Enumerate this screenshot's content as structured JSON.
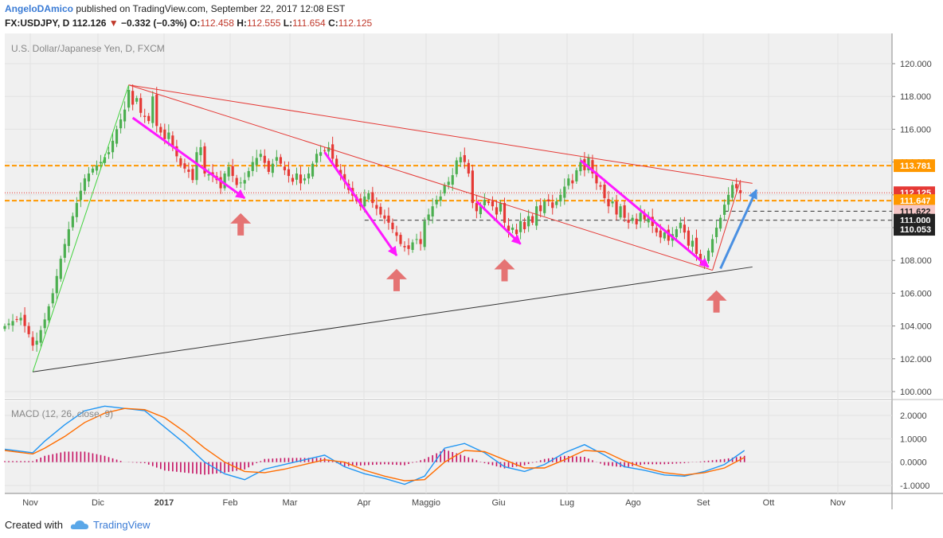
{
  "header": {
    "author": "AngeloDAmico",
    "published": "published on TradingView.com, September 22, 2017 12:08 EST",
    "symbol": "FX:USDJPY, D",
    "last": "112.126",
    "change": "−0.332 (−0.3%)",
    "o_label": "O:",
    "o_value": "112.458",
    "h_label": "H:",
    "h_value": "112.555",
    "l_label": "L:",
    "l_value": "111.654",
    "c_label": "C:",
    "c_value": "112.125"
  },
  "footer": {
    "created": "Created with",
    "brand": "TradingView"
  },
  "colors": {
    "up": "#4caf50",
    "down": "#e53935",
    "trend": "#e53935",
    "magenta": "#ff19ff",
    "orange": "#ff9800",
    "blue_arrow": "#4a90e2",
    "marker": "#e57373",
    "macd": "#2196f3",
    "signal": "#ff6d00",
    "hist": "#c51162",
    "bg": "#f0f0f0"
  },
  "icons": {
    "down_triangle": "triangle-down-icon",
    "up_marker": "arrow-up-icon",
    "brand": "cloud-icon"
  },
  "chart_data": [
    {
      "type": "candlestick",
      "title": "U.S. Dollar/Japanese Yen, D, FXCM",
      "ylim": [
        99.5,
        120.5
      ],
      "y_ticks": [
        "120.000",
        "118.000",
        "116.000",
        "114.000",
        "112.000",
        "110.000",
        "108.000",
        "106.000",
        "104.000",
        "102.000",
        "100.000"
      ],
      "x_ticks": [
        "Nov",
        "Dic",
        "2017",
        "Feb",
        "Mar",
        "Apr",
        "Maggio",
        "Giu",
        "Lug",
        "Ago",
        "Set",
        "Ott",
        "Nov"
      ],
      "price_path": [
        [
          0,
          104.0
        ],
        [
          2,
          104.3
        ],
        [
          4,
          104.5
        ],
        [
          5,
          104.0
        ],
        [
          6,
          103.5
        ],
        [
          7,
          102.8
        ],
        [
          8,
          103.1
        ],
        [
          10,
          104.4
        ],
        [
          12,
          106.0
        ],
        [
          14,
          108.1
        ],
        [
          16,
          109.9
        ],
        [
          18,
          111.5
        ],
        [
          20,
          113.0
        ],
        [
          22,
          113.6
        ],
        [
          24,
          114.0
        ],
        [
          26,
          114.6
        ],
        [
          28,
          116.0
        ],
        [
          30,
          117.2
        ],
        [
          31,
          118.4
        ],
        [
          32,
          117.5
        ],
        [
          33,
          117.9
        ],
        [
          34,
          117.0
        ],
        [
          36,
          116.5
        ],
        [
          37,
          118.0
        ],
        [
          38,
          116.2
        ],
        [
          40,
          115.4
        ],
        [
          41,
          115.8
        ],
        [
          42,
          114.9
        ],
        [
          44,
          113.8
        ],
        [
          46,
          113.4
        ],
        [
          47,
          112.9
        ],
        [
          48,
          114.6
        ],
        [
          49,
          114.9
        ],
        [
          50,
          113.3
        ],
        [
          52,
          113.2
        ],
        [
          53,
          112.9
        ],
        [
          54,
          112.4
        ],
        [
          55,
          113.3
        ],
        [
          56,
          113.7
        ],
        [
          58,
          112.6
        ],
        [
          60,
          112.9
        ],
        [
          62,
          114.0
        ],
        [
          64,
          114.5
        ],
        [
          66,
          113.4
        ],
        [
          67,
          113.9
        ],
        [
          68,
          114.3
        ],
        [
          70,
          113.5
        ],
        [
          72,
          112.8
        ],
        [
          73,
          113.3
        ],
        [
          74,
          112.7
        ],
        [
          76,
          113.3
        ],
        [
          78,
          114.5
        ],
        [
          80,
          114.7
        ],
        [
          81,
          114.9
        ],
        [
          82,
          114.2
        ],
        [
          84,
          113.2
        ],
        [
          85,
          112.8
        ],
        [
          86,
          112.3
        ],
        [
          88,
          111.6
        ],
        [
          89,
          111.3
        ],
        [
          90,
          111.9
        ],
        [
          91,
          112.1
        ],
        [
          92,
          111.5
        ],
        [
          94,
          110.8
        ],
        [
          96,
          110.3
        ],
        [
          98,
          109.5
        ],
        [
          99,
          109.0
        ],
        [
          100,
          108.8
        ],
        [
          101,
          108.7
        ],
        [
          102,
          109.1
        ],
        [
          103,
          109.3
        ],
        [
          104,
          109.0
        ],
        [
          105,
          110.4
        ],
        [
          106,
          110.8
        ],
        [
          107,
          111.3
        ],
        [
          108,
          111.7
        ],
        [
          109,
          111.9
        ],
        [
          110,
          112.6
        ],
        [
          111,
          112.8
        ],
        [
          112,
          113.2
        ],
        [
          113,
          114.1
        ],
        [
          114,
          114.3
        ],
        [
          115,
          114.0
        ],
        [
          116,
          113.3
        ],
        [
          117,
          111.5
        ],
        [
          118,
          111.0
        ],
        [
          119,
          111.3
        ],
        [
          120,
          111.7
        ],
        [
          121,
          111.5
        ],
        [
          122,
          111.3
        ],
        [
          123,
          110.8
        ],
        [
          124,
          111.5
        ],
        [
          125,
          110.3
        ],
        [
          126,
          109.8
        ],
        [
          127,
          110.0
        ],
        [
          128,
          109.6
        ],
        [
          129,
          110.4
        ],
        [
          130,
          109.9
        ],
        [
          131,
          110.7
        ],
        [
          132,
          110.3
        ],
        [
          133,
          111.3
        ],
        [
          134,
          111.0
        ],
        [
          135,
          111.6
        ],
        [
          136,
          111.6
        ],
        [
          137,
          111.2
        ],
        [
          138,
          111.6
        ],
        [
          139,
          112.0
        ],
        [
          140,
          112.5
        ],
        [
          141,
          113.0
        ],
        [
          142,
          112.7
        ],
        [
          143,
          113.5
        ],
        [
          144,
          114.0
        ],
        [
          145,
          113.5
        ],
        [
          146,
          114.3
        ],
        [
          147,
          113.3
        ],
        [
          148,
          112.7
        ],
        [
          149,
          112.5
        ],
        [
          150,
          111.8
        ],
        [
          151,
          111.3
        ],
        [
          152,
          111.6
        ],
        [
          153,
          110.8
        ],
        [
          154,
          111.3
        ],
        [
          155,
          110.6
        ],
        [
          156,
          110.3
        ],
        [
          157,
          110.6
        ],
        [
          158,
          110.2
        ],
        [
          159,
          110.9
        ],
        [
          160,
          110.5
        ],
        [
          161,
          110.6
        ],
        [
          162,
          110.1
        ],
        [
          163,
          109.7
        ],
        [
          164,
          109.4
        ],
        [
          165,
          109.7
        ],
        [
          166,
          109.2
        ],
        [
          167,
          109.6
        ],
        [
          168,
          109.9
        ],
        [
          169,
          110.3
        ],
        [
          170,
          109.7
        ],
        [
          171,
          108.9
        ],
        [
          172,
          109.2
        ],
        [
          173,
          108.4
        ],
        [
          174,
          108.0
        ],
        [
          175,
          107.9
        ],
        [
          176,
          108.6
        ],
        [
          177,
          109.3
        ],
        [
          178,
          110.0
        ],
        [
          179,
          110.6
        ],
        [
          180,
          111.4
        ],
        [
          181,
          112.0
        ],
        [
          182,
          112.6
        ],
        [
          183,
          112.4
        ],
        [
          184,
          112.1
        ]
      ],
      "price_labels": [
        {
          "text": "113.781",
          "value": 113.781,
          "bg": "#ff9800",
          "fg": "#ffffff"
        },
        {
          "text": "112.125",
          "value": 112.125,
          "bg": "#e53935",
          "fg": "#ffffff"
        },
        {
          "text": "111.647",
          "value": 111.647,
          "bg": "#ff9800",
          "fg": "#ffffff"
        },
        {
          "text": "111.622",
          "value": 111.0,
          "bg": "#f4c6c6",
          "fg": "#222222"
        },
        {
          "text": "111.000",
          "value": 110.45,
          "bg": "#222222",
          "fg": "#ffffff"
        },
        {
          "text": "110.053",
          "value": 109.9,
          "bg": "#222222",
          "fg": "#ffffff"
        }
      ],
      "horizontal_lines": [
        {
          "value": 113.781,
          "style": "orange-dashed"
        },
        {
          "value": 111.647,
          "style": "orange-dashed"
        },
        {
          "value": 112.125,
          "style": "red-dotted"
        },
        {
          "value": 111.0,
          "style": "black-dashed",
          "from": 180
        },
        {
          "value": 110.45,
          "style": "black-dashed",
          "from": 90
        }
      ],
      "trend_lines": [
        {
          "color": "green",
          "from": [
            7,
            101.2
          ],
          "to": [
            31,
            118.7
          ]
        },
        {
          "color": "red",
          "from": [
            31,
            118.7
          ],
          "to": [
            187,
            112.7
          ]
        },
        {
          "color": "red",
          "from": [
            31,
            118.7
          ],
          "to": [
            177,
            107.4
          ]
        },
        {
          "color": "black",
          "from": [
            7,
            101.2
          ],
          "to": [
            187,
            107.6
          ]
        },
        {
          "color": "red",
          "from": [
            177,
            107.4
          ],
          "to": [
            184,
            112.9
          ]
        }
      ],
      "magenta_arrows": [
        [
          [
            32,
            116.7
          ],
          [
            60,
            111.8
          ]
        ],
        [
          [
            80,
            114.6
          ],
          [
            98,
            108.3
          ]
        ],
        [
          [
            118,
            111.6
          ],
          [
            129,
            109.0
          ]
        ],
        [
          [
            144,
            114.1
          ],
          [
            176,
            107.6
          ]
        ]
      ],
      "blue_arrow": [
        [
          179,
          107.5
        ],
        [
          188,
          112.3
        ]
      ],
      "up_markers": [
        [
          59,
          110.2
        ],
        [
          98,
          106.8
        ],
        [
          125,
          107.4
        ],
        [
          178,
          105.5
        ]
      ]
    },
    {
      "type": "line",
      "title": "MACD (12, 26, close, 9)",
      "ylim": [
        -1.4,
        2.6
      ],
      "y_ticks": [
        "2.0000",
        "1.0000",
        "0.0000",
        "-1.0000"
      ],
      "x": [
        0,
        7,
        10,
        15,
        20,
        25,
        30,
        35,
        40,
        45,
        50,
        55,
        60,
        65,
        70,
        75,
        80,
        85,
        90,
        95,
        100,
        105,
        110,
        115,
        120,
        125,
        130,
        135,
        140,
        145,
        150,
        155,
        160,
        165,
        170,
        175,
        180,
        185
      ],
      "series": [
        {
          "name": "MACD",
          "values": [
            0.55,
            0.4,
            0.9,
            1.6,
            2.2,
            2.4,
            2.3,
            2.2,
            1.5,
            0.8,
            0.0,
            -0.5,
            -0.75,
            -0.3,
            -0.1,
            0.1,
            0.3,
            -0.2,
            -0.5,
            -0.7,
            -0.95,
            -0.6,
            0.6,
            0.8,
            0.4,
            -0.2,
            -0.4,
            -0.1,
            0.4,
            0.75,
            0.3,
            -0.2,
            -0.35,
            -0.55,
            -0.6,
            -0.4,
            -0.1,
            0.5
          ]
        },
        {
          "name": "Signal",
          "values": [
            0.5,
            0.35,
            0.6,
            1.1,
            1.7,
            2.1,
            2.3,
            2.25,
            1.9,
            1.3,
            0.6,
            0.0,
            -0.4,
            -0.45,
            -0.3,
            -0.1,
            0.1,
            0.0,
            -0.35,
            -0.6,
            -0.8,
            -0.75,
            0.0,
            0.5,
            0.45,
            0.1,
            -0.25,
            -0.25,
            0.1,
            0.5,
            0.45,
            0.05,
            -0.25,
            -0.45,
            -0.55,
            -0.45,
            -0.25,
            0.2
          ]
        }
      ]
    }
  ]
}
